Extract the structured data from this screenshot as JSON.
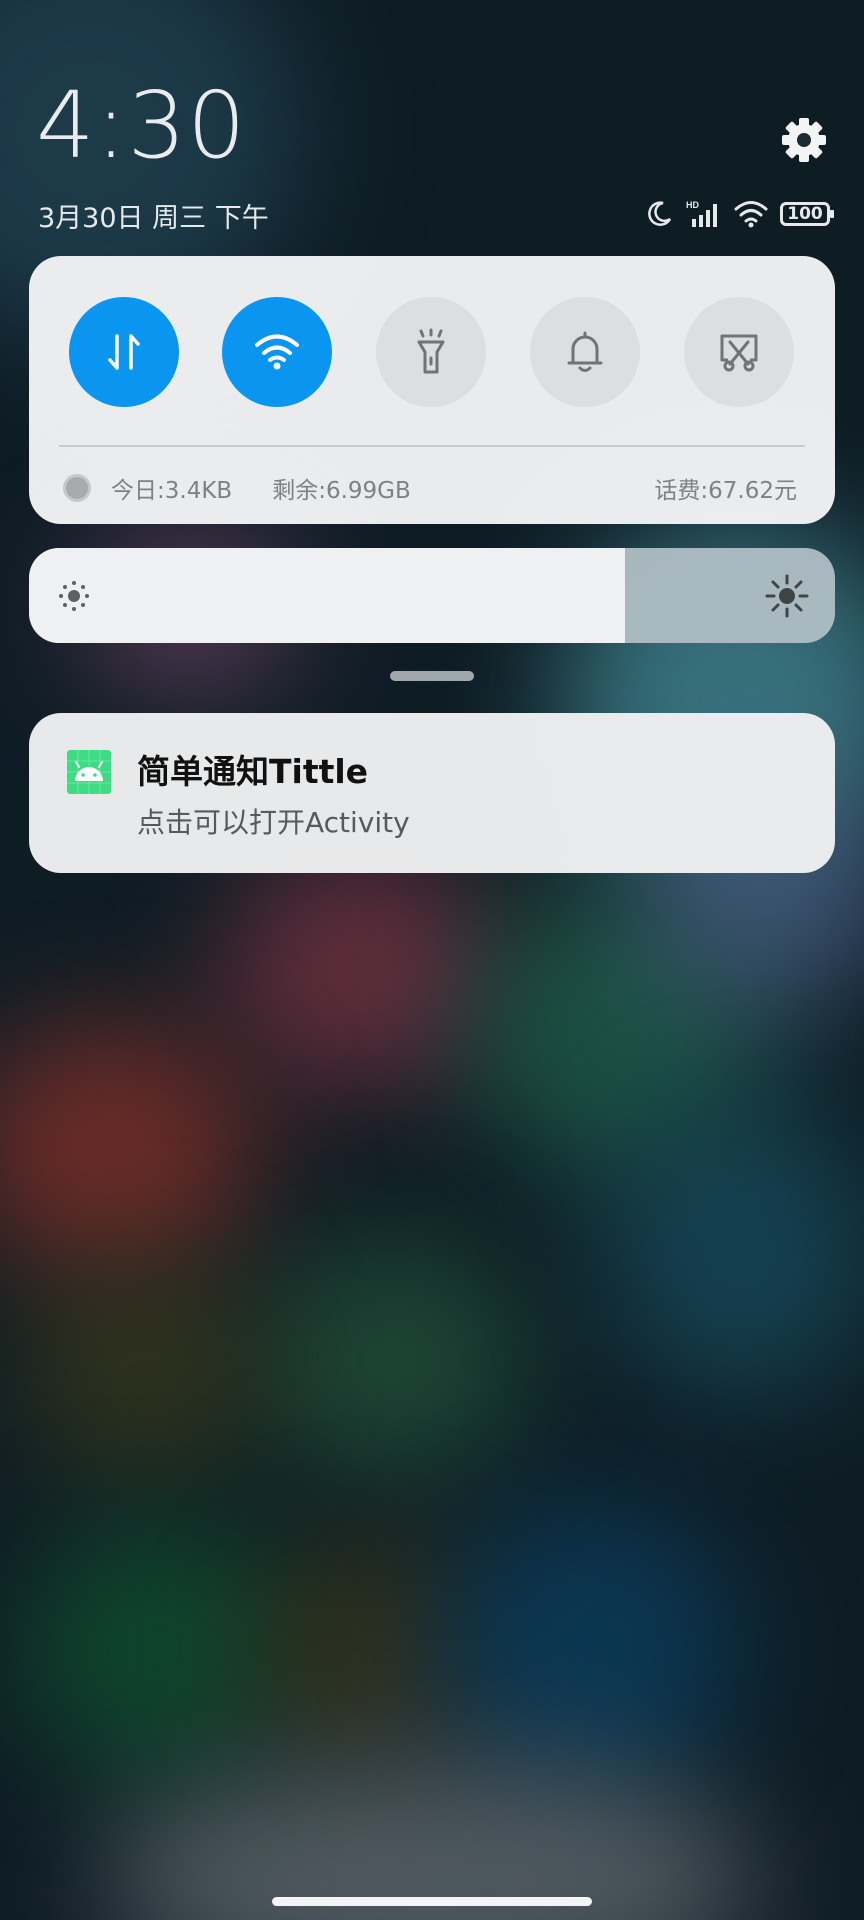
{
  "status": {
    "time": "4:30",
    "date": "3月30日 周三 下午",
    "battery": "100",
    "icons": [
      "moon-icon",
      "hd-signal-icon",
      "wifi-icon",
      "battery-icon"
    ]
  },
  "quick_settings": {
    "toggles": [
      {
        "name": "mobile-data",
        "icon": "data-arrows-icon",
        "on": true
      },
      {
        "name": "wifi",
        "icon": "wifi-icon",
        "on": true
      },
      {
        "name": "flashlight",
        "icon": "flashlight-icon",
        "on": false
      },
      {
        "name": "sound",
        "icon": "bell-icon",
        "on": false
      },
      {
        "name": "screenshot",
        "icon": "screenshot-icon",
        "on": false
      }
    ],
    "data_today": "今日:3.4KB",
    "data_remaining": "剩余:6.99GB",
    "balance": "话费:67.62元"
  },
  "brightness": {
    "level_percent": 74
  },
  "notification": {
    "app_icon": "android-icon",
    "title": "简单通知Tittle",
    "text": "点击可以打开Activity"
  },
  "colors": {
    "accent": "#0a96f0",
    "app_icon": "#3ddc84"
  }
}
